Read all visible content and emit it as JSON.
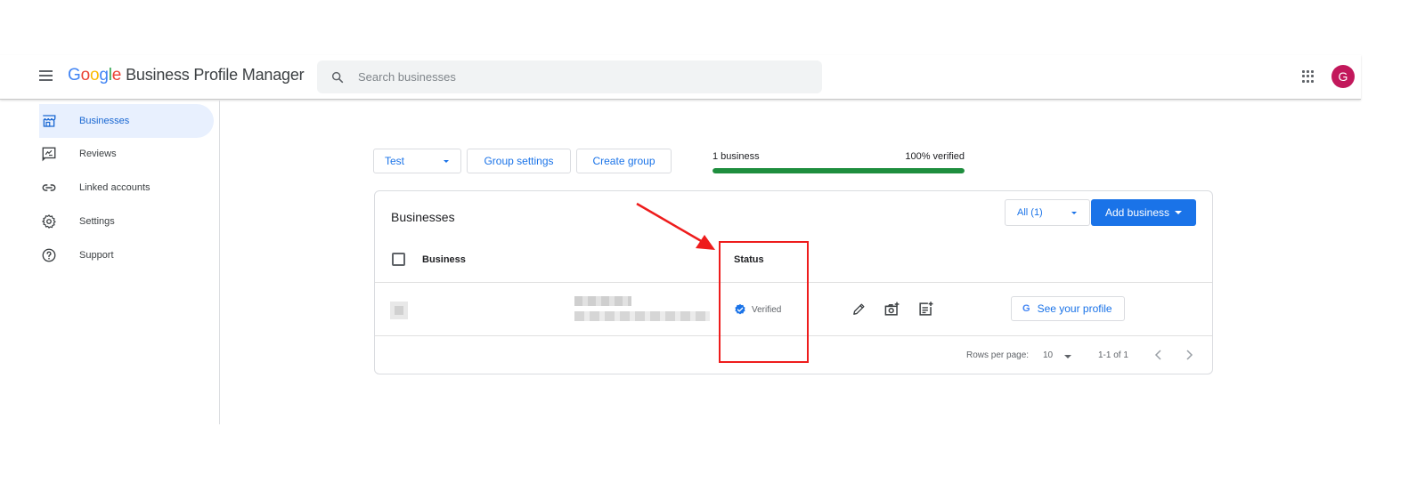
{
  "header": {
    "logo_letters": [
      {
        "char": "G",
        "color": "#4285f4"
      },
      {
        "char": "o",
        "color": "#ea4335"
      },
      {
        "char": "o",
        "color": "#fbbc05"
      },
      {
        "char": "g",
        "color": "#4285f4"
      },
      {
        "char": "l",
        "color": "#34a853"
      },
      {
        "char": "e",
        "color": "#ea4335"
      }
    ],
    "product_name": "Business Profile Manager",
    "search_placeholder": "Search businesses",
    "avatar_initial": "G",
    "avatar_color": "#c2185b"
  },
  "sidebar": {
    "items": [
      {
        "label": "Businesses",
        "icon": "storefront-icon",
        "active": true
      },
      {
        "label": "Reviews",
        "icon": "reviews-icon",
        "active": false
      },
      {
        "label": "Linked accounts",
        "icon": "link-icon",
        "active": false
      },
      {
        "label": "Settings",
        "icon": "gear-icon",
        "active": false
      },
      {
        "label": "Support",
        "icon": "help-icon",
        "active": false
      }
    ]
  },
  "toolbar": {
    "group_select_value": "Test",
    "group_settings_label": "Group settings",
    "create_group_label": "Create group"
  },
  "stats": {
    "business_count_text": "1 business",
    "verified_text": "100% verified",
    "verified_fraction": 1.0
  },
  "card": {
    "title": "Businesses",
    "filter_value": "All (1)",
    "add_business_label": "Add business",
    "columns": {
      "business": "Business",
      "status": "Status"
    },
    "rows": [
      {
        "status": "Verified",
        "profile_button": "See your profile",
        "profile_button_glyph": "G"
      }
    ],
    "footer": {
      "rows_per_page_label": "Rows per page:",
      "rows_per_page_value": "10",
      "range_text": "1-1 of 1"
    }
  },
  "colors": {
    "accent": "#1a73e8",
    "verified_badge": "#1a73e8",
    "progress_fill": "#1e8e3e",
    "annotation_red": "#ee1c1c"
  }
}
